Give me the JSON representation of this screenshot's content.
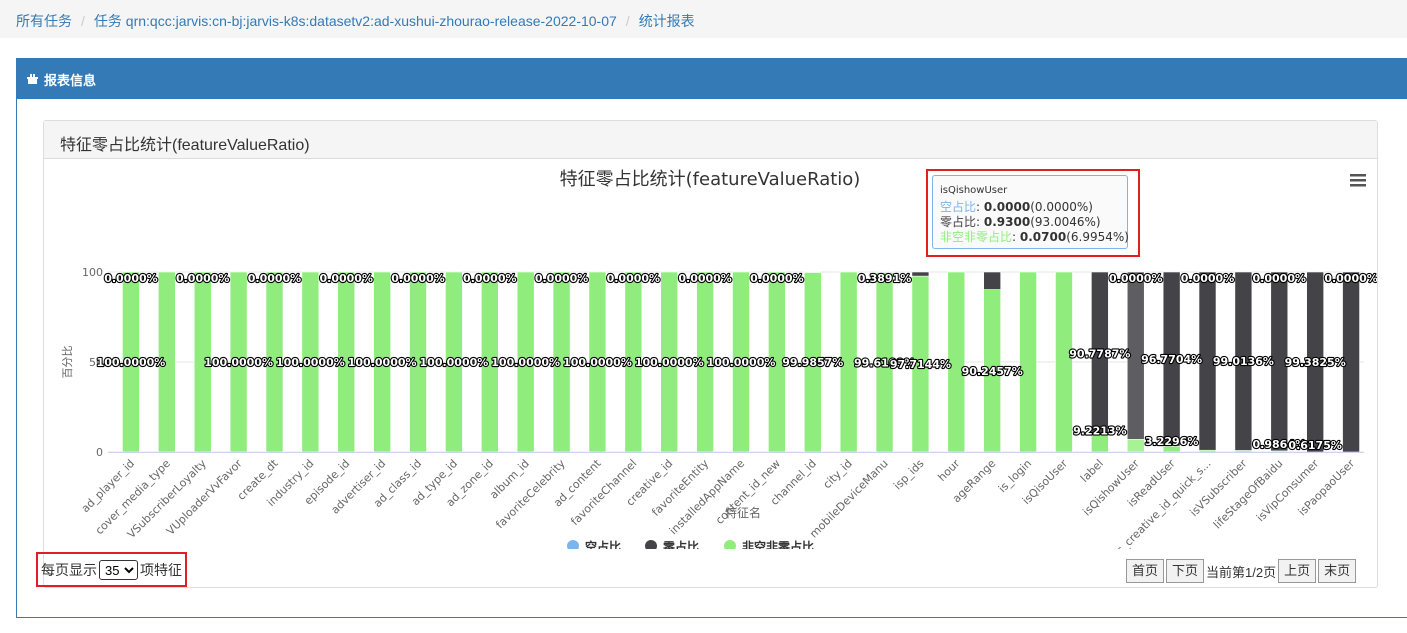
{
  "breadcrumb": {
    "items": [
      "所有任务",
      "任务 qrn:qcc:jarvis:cn-bj:jarvis-k8s:datasetv2:ad-xushui-zhourao-release-2022-10-07",
      "统计报表"
    ]
  },
  "panel": {
    "title": "报表信息",
    "icon": "gift-icon"
  },
  "inner_panel": {
    "title": "特征零占比统计(featureValueRatio)"
  },
  "chart_data": {
    "type": "bar",
    "stacked": true,
    "title": "特征零占比统计(featureValueRatio)",
    "xlabel": "特征名",
    "ylabel": "百分比",
    "ylim": [
      0,
      100
    ],
    "yticks": [
      0,
      50,
      100
    ],
    "legend_position": "bottom-center",
    "categories": [
      "ad_player_id",
      "cover_media_type",
      "VSubscriberLoyalty",
      "VUploaderVvFavor",
      "create_dt",
      "industry_id",
      "episode_id",
      "advertiser_id",
      "ad_class_id",
      "ad_type_id",
      "ad_zone_id",
      "album_id",
      "favoriteCelebrity",
      "ad_content",
      "favoriteChannel",
      "creative_id",
      "favoriteEntity",
      "installedAppName",
      "content_id_new",
      "channel_id",
      "city_id",
      "mobileDeviceManu",
      "isp_ids",
      "hour",
      "ageRange",
      "is_login",
      "isQisoUser",
      "label",
      "isQishowUser",
      "isReadUser",
      "is_creative_id_quick_s...",
      "isVSubscriber",
      "lifeStageOfBaidu",
      "isVipConsumer",
      "isPaopaoUser"
    ],
    "series": [
      {
        "name": "空占比",
        "color": "#7cb5ec",
        "values": [
          0,
          0,
          0,
          0,
          0,
          0,
          0,
          0,
          0,
          0,
          0,
          0,
          0,
          0,
          0,
          0,
          0,
          0,
          0,
          0,
          0,
          0,
          0,
          0,
          0,
          0,
          0,
          0,
          0,
          0,
          0,
          0,
          0,
          0,
          0
        ]
      },
      {
        "name": "零占比",
        "color": "#434348",
        "values": [
          0,
          0,
          0,
          0,
          0,
          0,
          0,
          0,
          0,
          0,
          0,
          0,
          0,
          0,
          0,
          0,
          0,
          0,
          0,
          0.0143,
          0,
          0.3891,
          2.2856,
          0,
          9.7543,
          0,
          0,
          90.7787,
          93.0046,
          96.7704,
          99.0136,
          99.1383,
          99.3825,
          100,
          100
        ]
      },
      {
        "name": "非空非零占比",
        "color": "#90ed7d",
        "values": [
          100,
          100,
          100,
          100,
          100,
          100,
          100,
          100,
          100,
          100,
          100,
          100,
          100,
          100,
          100,
          100,
          100,
          100,
          100,
          99.9857,
          100,
          99.6109,
          97.7144,
          100,
          90.2457,
          100,
          100,
          9.2213,
          6.9954,
          3.2296,
          0.9864,
          0.8617,
          0.6175,
          0,
          0
        ]
      }
    ],
    "data_labels": [
      {
        "category": "ad_player_id",
        "series": "空占比",
        "text": "0.0000%"
      },
      {
        "category": "VSubscriberLoyalty",
        "series": "空占比",
        "text": "0.0000%"
      },
      {
        "category": "create_dt",
        "series": "空占比",
        "text": "0.0000%"
      },
      {
        "category": "episode_id",
        "series": "空占比",
        "text": "0.0000%"
      },
      {
        "category": "ad_class_id",
        "series": "空占比",
        "text": "0.0000%"
      },
      {
        "category": "ad_zone_id",
        "series": "空占比",
        "text": "0.0000%"
      },
      {
        "category": "favoriteCelebrity",
        "series": "空占比",
        "text": "0.0000%"
      },
      {
        "category": "favoriteChannel",
        "series": "空占比",
        "text": "0.0000%"
      },
      {
        "category": "favoriteEntity",
        "series": "空占比",
        "text": "0.0000%"
      },
      {
        "category": "content_id_new",
        "series": "空占比",
        "text": "0.0000%"
      },
      {
        "category": "mobileDeviceManu",
        "series": "零占比",
        "text": "0.3891%"
      },
      {
        "category": "isQishowUser",
        "series": "空占比",
        "text": "0.0000%"
      },
      {
        "category": "is_creative_id_quick_s...",
        "series": "空占比",
        "text": "0.0000%"
      },
      {
        "category": "lifeStageOfBaidu",
        "series": "空占比",
        "text": "0.0000%"
      },
      {
        "category": "isPaopaoUser",
        "series": "空占比",
        "text": "0.0000%"
      },
      {
        "category": "ad_player_id",
        "series": "非空非零占比",
        "text": "100.0000%"
      },
      {
        "category": "VUploaderVvFavor",
        "series": "非空非零占比",
        "text": "100.0000%"
      },
      {
        "category": "industry_id",
        "series": "非空非零占比",
        "text": "100.0000%"
      },
      {
        "category": "advertiser_id",
        "series": "非空非零占比",
        "text": "100.0000%"
      },
      {
        "category": "ad_type_id",
        "series": "非空非零占比",
        "text": "100.0000%"
      },
      {
        "category": "album_id",
        "series": "非空非零占比",
        "text": "100.0000%"
      },
      {
        "category": "ad_content",
        "series": "非空非零占比",
        "text": "100.0000%"
      },
      {
        "category": "creative_id",
        "series": "非空非零占比",
        "text": "100.0000%"
      },
      {
        "category": "installedAppName",
        "series": "非空非零占比",
        "text": "100.0000%"
      },
      {
        "category": "channel_id",
        "series": "非空非零占比",
        "text": "99.9857%"
      },
      {
        "category": "mobileDeviceManu",
        "series": "非空非零占比",
        "text": "99.6109%"
      },
      {
        "category": "isp_ids",
        "series": "非空非零占比",
        "text": "97.7144%"
      },
      {
        "category": "ageRange",
        "series": "非空非零占比",
        "text": "90.2457%"
      },
      {
        "category": "label",
        "series": "零占比",
        "text": "90.7787%"
      },
      {
        "category": "isReadUser",
        "series": "零占比",
        "text": "96.7704%"
      },
      {
        "category": "isVSubscriber",
        "series": "零占比",
        "text": "99.0136%"
      },
      {
        "category": "isVipConsumer",
        "series": "零占比",
        "text": "99.3825%"
      },
      {
        "category": "label",
        "series": "非空非零占比",
        "text": "9.2213%"
      },
      {
        "category": "isReadUser",
        "series": "非空非零占比",
        "text": "3.2296%"
      },
      {
        "category": "lifeStageOfBaidu",
        "series": "非空非零占比",
        "text": "0.9864%"
      },
      {
        "category": "isVipConsumer",
        "series": "非空非零占比",
        "text": "0.6175%"
      }
    ],
    "tooltip": {
      "category": "isQishowUser",
      "rows": [
        {
          "series": "空占比",
          "value": "0.0000",
          "pct": "(0.0000%)"
        },
        {
          "series": "零占比",
          "value": "0.9300",
          "pct": "(93.0046%)"
        },
        {
          "series": "非空非零占比",
          "value": "0.0700",
          "pct": "(6.9954%)"
        }
      ]
    },
    "highlighted_category": "isQishowUser"
  },
  "pager": {
    "prefix": "每页显示",
    "page_size": "35",
    "suffix": "项特征",
    "first": "首页",
    "next": "下页",
    "status": "当前第1/2页",
    "prev": "上页",
    "last": "末页"
  },
  "colors": {
    "primary": "#337ab7",
    "highlight_box": "#e02020"
  }
}
